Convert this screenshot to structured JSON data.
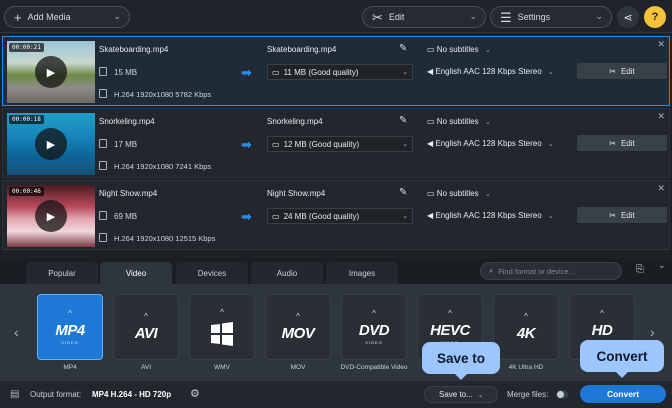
{
  "toolbar": {
    "add_media": "Add Media",
    "edit": "Edit",
    "settings": "Settings",
    "help": "?"
  },
  "files": [
    {
      "duration": "00:00:21",
      "name": "Skateboarding.mp4",
      "size": "15 MB",
      "codec": "H.264 1920x1080 5782 Kbps",
      "output_name": "Skateboarding.mp4",
      "output_size": "11 MB (Good quality)",
      "subtitles": "No subtitles",
      "audio": "English AAC 128 Kbps Stereo",
      "edit": "Edit"
    },
    {
      "duration": "00:00:18",
      "name": "Snorkeling.mp4",
      "size": "17 MB",
      "codec": "H.264 1920x1080 7241 Kbps",
      "output_name": "Snorkeling.mp4",
      "output_size": "12 MB (Good quality)",
      "subtitles": "No subtitles",
      "audio": "English AAC 128 Kbps Stereo",
      "edit": "Edit"
    },
    {
      "duration": "00:00:46",
      "name": "Night Show.mp4",
      "size": "69 MB",
      "codec": "H.264 1920x1080 12515 Kbps",
      "output_name": "Night Show.mp4",
      "output_size": "24 MB (Good quality)",
      "subtitles": "No subtitles",
      "audio": "English AAC 128 Kbps Stereo",
      "edit": "Edit"
    }
  ],
  "tabs": [
    "Popular",
    "Video",
    "Devices",
    "Audio",
    "Images"
  ],
  "search_placeholder": "Find format or device...",
  "formats": [
    {
      "logo": "MP4",
      "sub": "VIDEO",
      "label": "MP4"
    },
    {
      "logo": "AVI",
      "sub": "",
      "label": "AVI"
    },
    {
      "logo": "",
      "sub": "",
      "label": "WMV"
    },
    {
      "logo": "MOV",
      "sub": "",
      "label": "MOV"
    },
    {
      "logo": "DVD",
      "sub": "VIDEO",
      "label": "DVD-Compatible Video"
    },
    {
      "logo": "HEVC",
      "sub": "VIDEO",
      "label": "HEVC"
    },
    {
      "logo": "4K",
      "sub": "",
      "label": "4K Ultra HD"
    },
    {
      "logo": "HD",
      "sub": "VIDEO",
      "label": "HD"
    }
  ],
  "bottom": {
    "output_label": "Output format:",
    "output_value": "MP4 H.264 - HD 720p",
    "save_to": "Save to...",
    "merge": "Merge files:",
    "convert": "Convert"
  },
  "tooltips": {
    "save_to": "Save to",
    "convert": "Convert"
  },
  "colors": {
    "accent": "#1e78d6",
    "tooltip": "#9dc6ff",
    "selected_border": "#2c8be8"
  }
}
